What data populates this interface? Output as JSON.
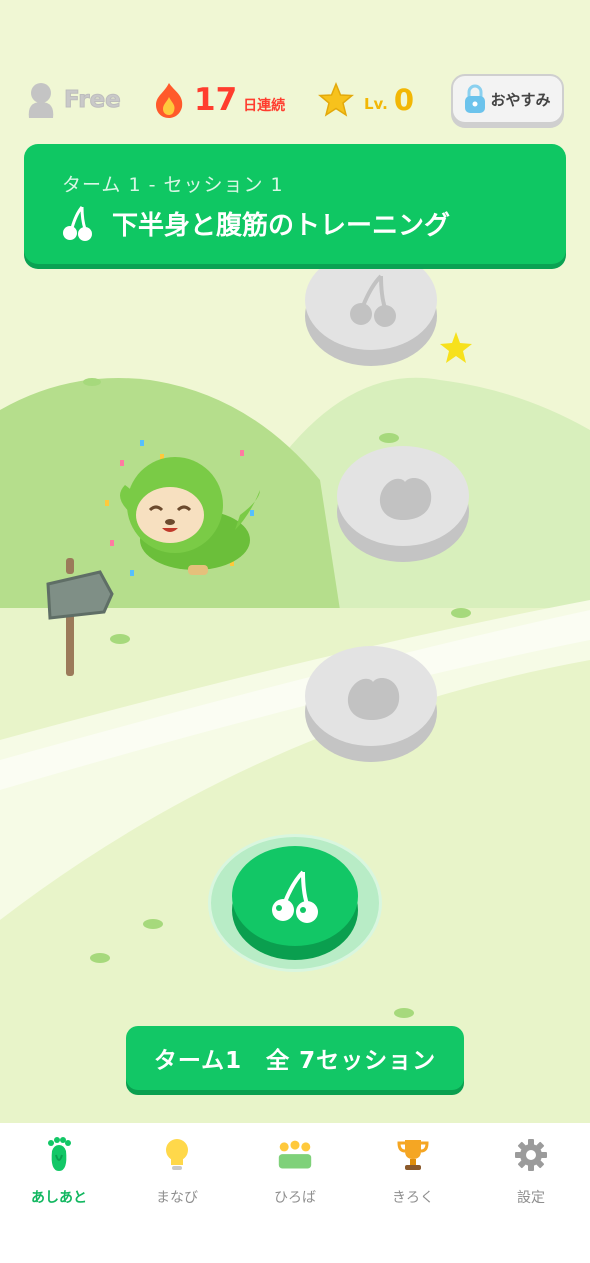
{
  "topbar": {
    "plan_label": "Free",
    "streak_count": "17",
    "streak_unit": "日連続",
    "level_prefix": "Lv.",
    "level_value": "0",
    "rest_button_label": "おやすみ"
  },
  "session_card": {
    "subtitle": "ターム 1 - セッション 1",
    "title": "下半身と腹筋のトレーニング"
  },
  "path_nodes": [
    {
      "icon": "cherry-icon",
      "state": "locked"
    },
    {
      "icon": "peach-icon",
      "state": "locked"
    },
    {
      "icon": "peach-icon",
      "state": "locked"
    },
    {
      "icon": "cherry-icon",
      "state": "current"
    }
  ],
  "term_button_label": "ターム1　全 7セッション",
  "tabs": [
    {
      "label": "あしあと",
      "icon": "footprint-icon",
      "active": true
    },
    {
      "label": "まなび",
      "icon": "lightbulb-icon",
      "active": false
    },
    {
      "label": "ひろば",
      "icon": "people-icon",
      "active": false
    },
    {
      "label": "きろく",
      "icon": "trophy-icon",
      "active": false
    },
    {
      "label": "設定",
      "icon": "gear-icon",
      "active": false
    }
  ],
  "colors": {
    "accent": "#12c766",
    "streak": "#ff3d2e",
    "level": "#f2b705",
    "background": "#f0f7d4"
  }
}
